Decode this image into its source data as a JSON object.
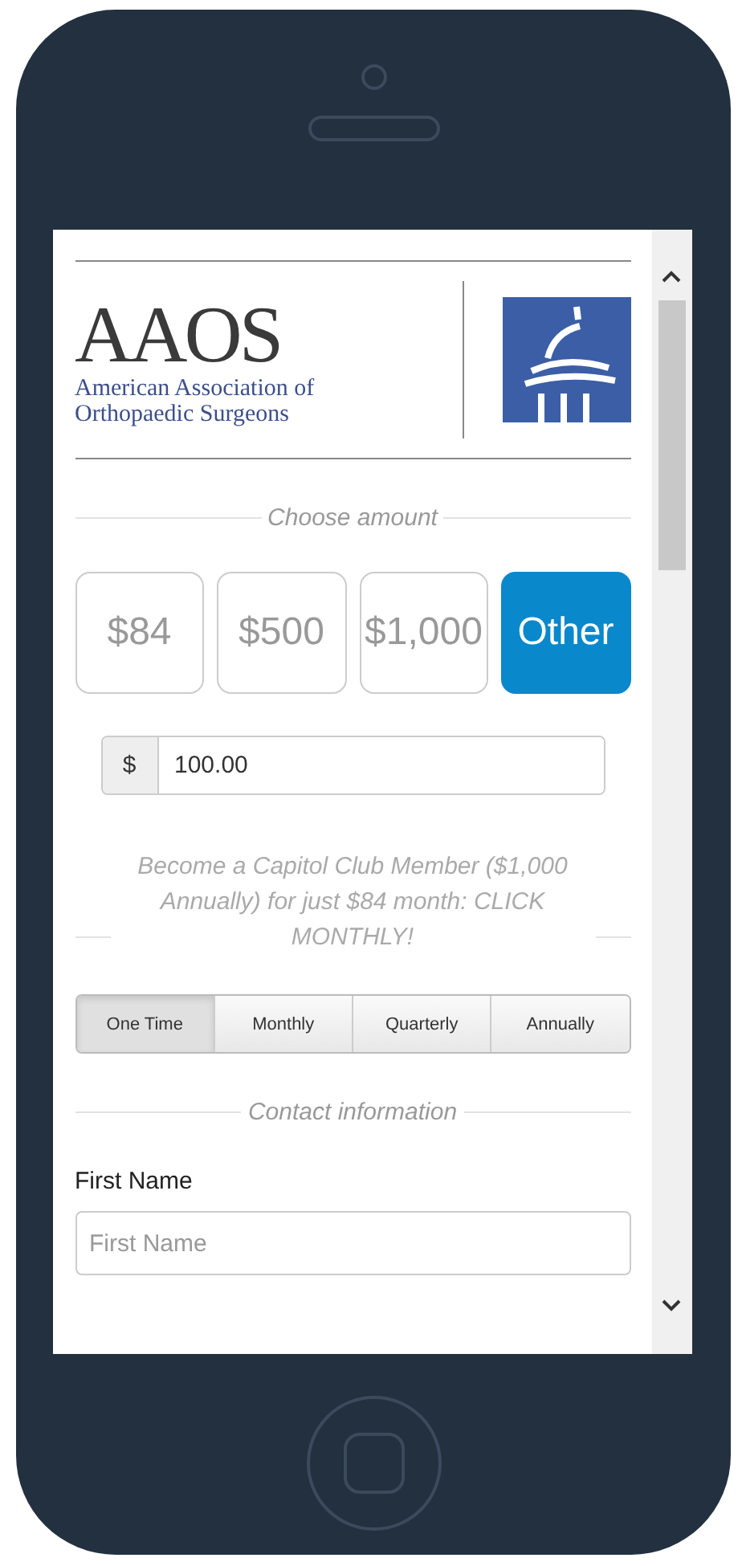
{
  "logo": {
    "acronym": "AAOS",
    "name_lines": [
      "American Association of",
      "Orthopaedic Surgeons"
    ]
  },
  "amount_section": {
    "heading": "Choose amount",
    "amounts": [
      {
        "label": "$84",
        "selected": false
      },
      {
        "label": "$500",
        "selected": false
      },
      {
        "label": "$1,000",
        "selected": false
      },
      {
        "label": "Other",
        "selected": true
      }
    ],
    "currency_symbol": "$",
    "amount_value": "100.00"
  },
  "promo_text": "Become a Capitol Club Member ($1,000 Annually) for just $84 month: CLICK MONTHLY!",
  "frequencies": [
    {
      "label": "One Time",
      "selected": true
    },
    {
      "label": "Monthly",
      "selected": false
    },
    {
      "label": "Quarterly",
      "selected": false
    },
    {
      "label": "Annually",
      "selected": false
    }
  ],
  "contact_section": {
    "heading": "Contact information",
    "fields": [
      {
        "label": "First Name",
        "placeholder": "First Name"
      }
    ]
  }
}
